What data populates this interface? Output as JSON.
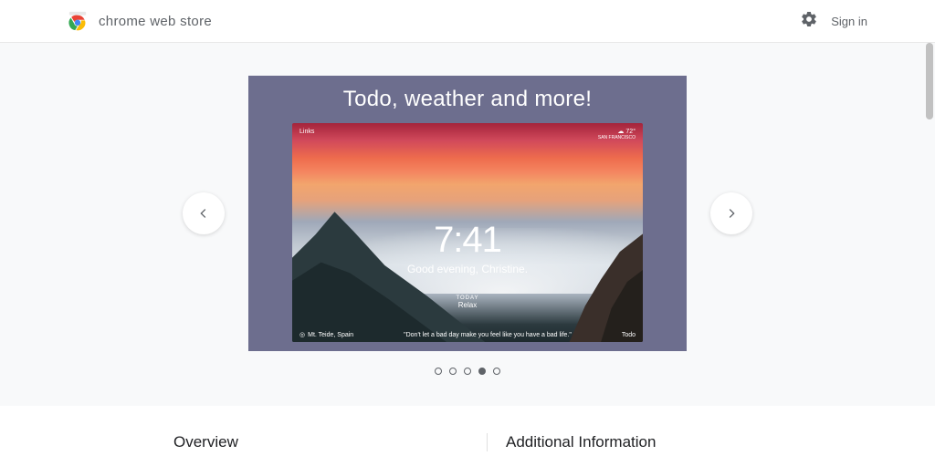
{
  "header": {
    "title": "chrome web store",
    "signin": "Sign in"
  },
  "carousel": {
    "headline": "Todo, weather and more!",
    "preview": {
      "links_label": "Links",
      "temp": "72°",
      "location": "SAN FRANCISCO",
      "time": "7:41",
      "greeting": "Good evening, Christine.",
      "today_label": "TODAY",
      "today_value": "Relax",
      "photo_credit": "Mt. Teide, Spain",
      "quote": "\"Don't let a bad day make you feel like you have a bad life.\"",
      "brand": "Todo"
    },
    "dots": {
      "count": 5,
      "active_index": 3
    }
  },
  "details": {
    "overview_heading": "Overview",
    "additional_heading": "Additional Information"
  }
}
